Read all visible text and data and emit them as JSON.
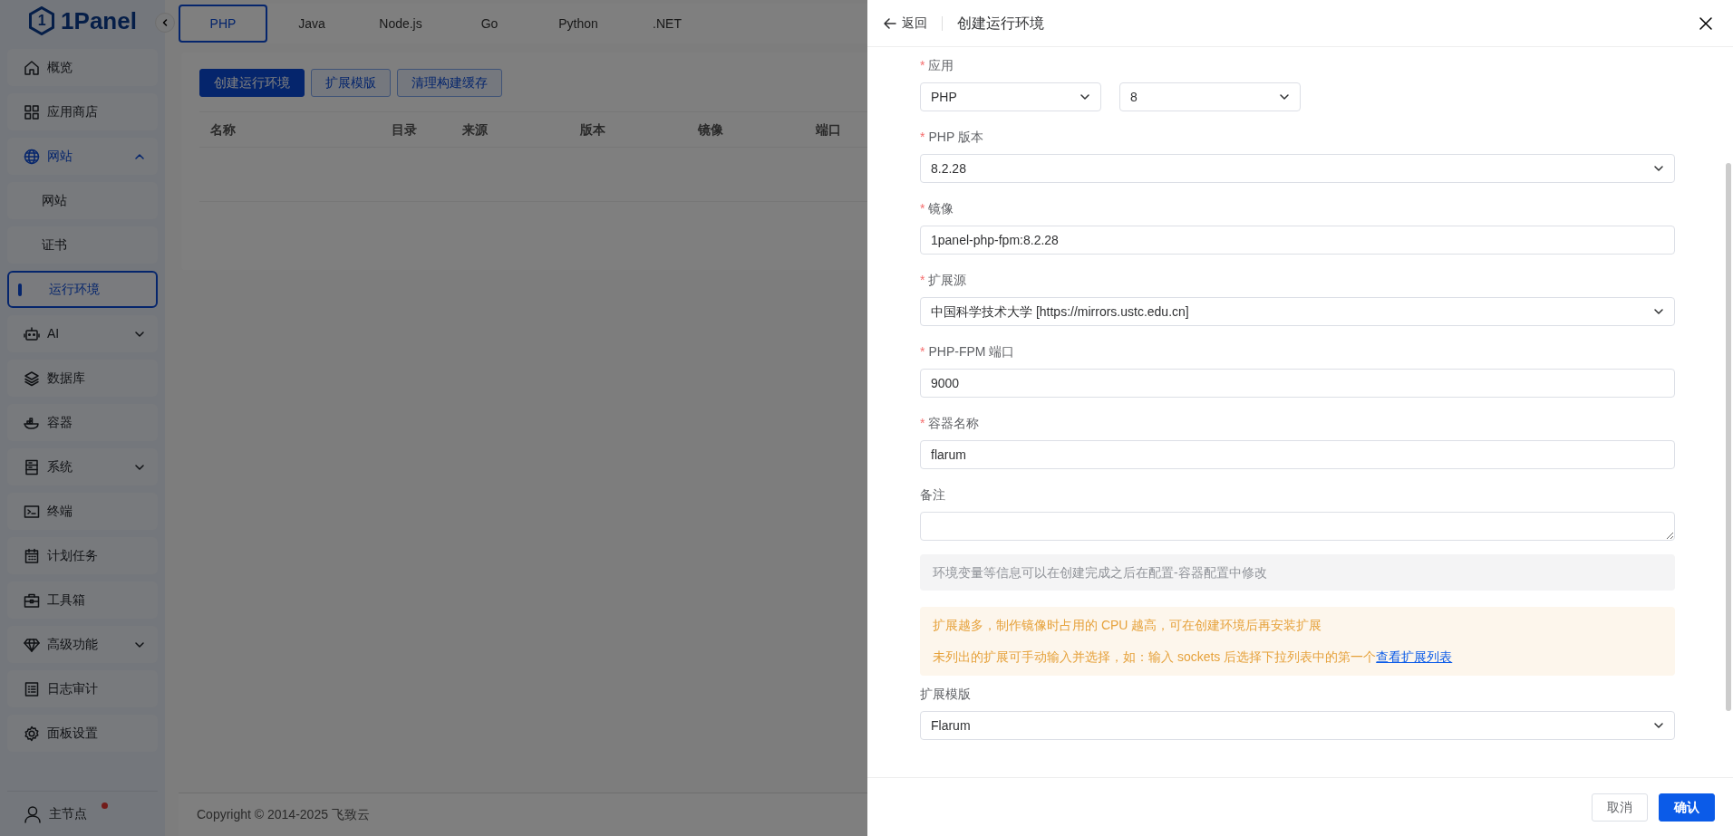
{
  "sidebar": {
    "logo": {
      "mark": "1",
      "text": "1Panel"
    },
    "items": [
      {
        "label": "概览",
        "selected": false
      },
      {
        "label": "应用商店",
        "selected": false
      },
      {
        "label": "网站",
        "selected": false,
        "expanded": true,
        "children": [
          {
            "label": "网站",
            "selected": false
          },
          {
            "label": "证书",
            "selected": false
          },
          {
            "label": "运行环境",
            "selected": true
          }
        ]
      },
      {
        "label": "AI",
        "selected": false,
        "expanded": false
      },
      {
        "label": "数据库",
        "selected": false
      },
      {
        "label": "容器",
        "selected": false
      },
      {
        "label": "系统",
        "selected": false,
        "expanded": false
      },
      {
        "label": "终端",
        "selected": false
      },
      {
        "label": "计划任务",
        "selected": false
      },
      {
        "label": "工具箱",
        "selected": false
      },
      {
        "label": "高级功能",
        "selected": false,
        "expanded": false
      },
      {
        "label": "日志审计",
        "selected": false
      },
      {
        "label": "面板设置",
        "selected": false
      }
    ],
    "node": {
      "label": "主节点",
      "notification": true
    }
  },
  "tabs": [
    {
      "label": "PHP",
      "selected": true
    },
    {
      "label": "Java",
      "selected": false
    },
    {
      "label": "Node.js",
      "selected": false
    },
    {
      "label": "Go",
      "selected": false
    },
    {
      "label": "Python",
      "selected": false
    },
    {
      "label": ".NET",
      "selected": false
    }
  ],
  "toolbar": [
    {
      "label": "创建运行环境",
      "kind": "primary"
    },
    {
      "label": "扩展模版",
      "kind": "outline"
    },
    {
      "label": "清理构建缓存",
      "kind": "outline"
    }
  ],
  "table": {
    "columns": [
      "名称",
      "目录",
      "来源",
      "版本",
      "镜像",
      "端口"
    ]
  },
  "footer": "Copyright © 2014-2025 飞致云",
  "drawer": {
    "back": "返回",
    "title": "创建运行环境",
    "fields": [
      {
        "label": "应用",
        "required_mark": "*",
        "controls": [
          {
            "kind": "select",
            "value": "PHP"
          },
          {
            "kind": "select",
            "value": "8"
          }
        ]
      },
      {
        "label": "PHP 版本",
        "required_mark": "*",
        "controls": [
          {
            "kind": "select",
            "value": "8.2.28"
          }
        ]
      },
      {
        "label": "镜像",
        "required_mark": "*",
        "controls": [
          {
            "kind": "input",
            "value": "1panel-php-fpm:8.2.28"
          }
        ]
      },
      {
        "label": "扩展源",
        "required_mark": "*",
        "controls": [
          {
            "kind": "select",
            "value": "中国科学技术大学 [https://mirrors.ustc.edu.cn]"
          }
        ]
      },
      {
        "label": "PHP-FPM 端口",
        "required_mark": "*",
        "controls": [
          {
            "kind": "input",
            "value": "9000"
          }
        ]
      },
      {
        "label": "容器名称",
        "required_mark": "*",
        "controls": [
          {
            "kind": "input",
            "value": "flarum"
          }
        ]
      },
      {
        "label": "备注",
        "controls": [
          {
            "kind": "textarea"
          }
        ]
      }
    ],
    "info": "环境变量等信息可以在创建完成之后在配置-容器配置中修改",
    "warning": [
      {
        "text": "扩展越多，制作镜像时占用的 CPU 越高，可在创建环境后再安装扩展"
      },
      {
        "text": "未列出的扩展可手动输入并选择，如：输入 sockets 后选择下拉列表中的第一个",
        "link": "查看扩展列表"
      }
    ],
    "template": {
      "label": "扩展模版",
      "controls": [
        {
          "kind": "select",
          "value": "Flarum"
        }
      ]
    },
    "buttons": [
      {
        "label": "取消",
        "kind": "default"
      },
      {
        "label": "确认",
        "kind": "primary"
      }
    ]
  }
}
